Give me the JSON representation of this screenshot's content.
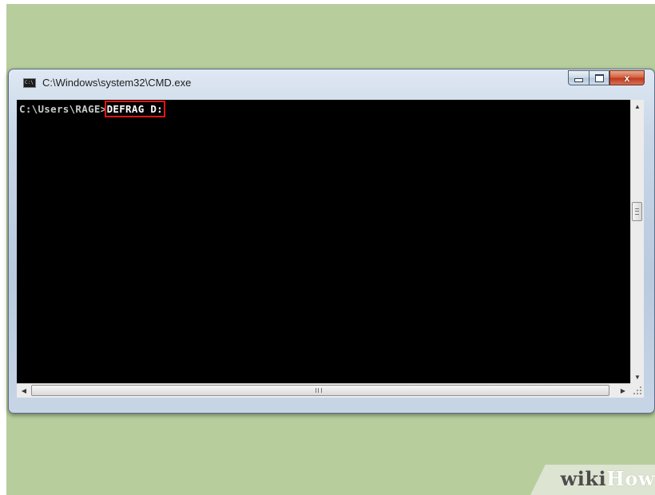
{
  "window": {
    "title": "C:\\Windows\\system32\\CMD.exe",
    "icon": "cmd-icon",
    "controls": {
      "minimize_icon": "minimize-icon",
      "maximize_icon": "maximize-icon",
      "close_glyph": "x"
    }
  },
  "console": {
    "prompt": "C:\\Users\\RAGE>",
    "command": "DEFRAG D:",
    "background_color": "#000000",
    "text_color": "#c0c0c0",
    "highlight_color": "#e01616"
  },
  "scrollbars": {
    "vertical_up_arrow": "▲",
    "vertical_down_arrow": "▼",
    "horizontal_left_arrow": "◀",
    "horizontal_right_arrow": "▶"
  },
  "watermark": {
    "part1": "wiki",
    "part2": "How"
  },
  "colors": {
    "backdrop": "#b7ce9c",
    "close_button": "#c0391b"
  }
}
